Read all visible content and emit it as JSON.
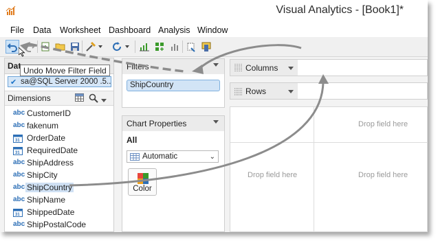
{
  "window": {
    "title": "Visual Analytics - [Book1]*"
  },
  "menu": [
    "File",
    "Data",
    "Worksheet",
    "Dashboard",
    "Analysis",
    "Window"
  ],
  "toolbar": {
    "icons": [
      "undo-icon",
      "redo-icon",
      "new-sheet-icon",
      "open-icon",
      "save-icon",
      "data-source-icon",
      "refresh-icon",
      "chart-icon",
      "add-chart-icon",
      "bar-chart-icon",
      "clear-icon",
      "present-icon"
    ]
  },
  "data_panel": {
    "header": "Dat",
    "connection": "sa@SQL Server 2000 .5...",
    "dimensions_label": "Dimensions",
    "fields": [
      {
        "type": "abc",
        "name": "CustomerID"
      },
      {
        "type": "abc",
        "name": "fakenum"
      },
      {
        "type": "date",
        "name": "OrderDate"
      },
      {
        "type": "date",
        "name": "RequiredDate"
      },
      {
        "type": "abc",
        "name": "ShipAddress"
      },
      {
        "type": "abc",
        "name": "ShipCity"
      },
      {
        "type": "abc",
        "name": "ShipCountry"
      },
      {
        "type": "abc",
        "name": "ShipName"
      },
      {
        "type": "date",
        "name": "ShippedDate"
      },
      {
        "type": "abc",
        "name": "ShipPostalCode"
      }
    ],
    "selected_field": "ShipCountry",
    "field_type_labels": {
      "abc": "abc",
      "date": ""
    }
  },
  "tooltip": "Undo Move Filter Field",
  "filters": {
    "title": "Filters",
    "pill": "ShipCountry"
  },
  "chart_properties": {
    "title": "Chart Properties",
    "scope": "All",
    "chart_type": "Automatic",
    "color_label": "Color"
  },
  "shelves": {
    "columns": "Columns",
    "rows": "Rows"
  },
  "canvas": {
    "drop_text": "Drop field here"
  },
  "colors": {
    "accent": "#2d6fb6",
    "selection": "#d2e4f6",
    "arrow": "#8c8c8c"
  }
}
